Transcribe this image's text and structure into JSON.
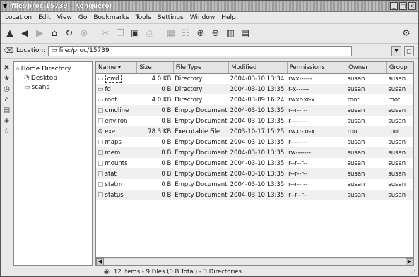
{
  "window": {
    "title": "file:/proc/15739 - Konqueror",
    "controls": [
      "_",
      "□",
      "×"
    ]
  },
  "menubar": [
    "Location",
    "Edit",
    "View",
    "Go",
    "Bookmarks",
    "Tools",
    "Settings",
    "Window",
    "Help"
  ],
  "toolbar": {
    "icons": [
      {
        "name": "up-arrow-icon",
        "glyph": "▲"
      },
      {
        "name": "back-arrow-icon",
        "glyph": "◀"
      },
      {
        "name": "forward-arrow-icon",
        "glyph": "▶"
      },
      {
        "name": "home-icon",
        "glyph": "⌂"
      },
      {
        "name": "reload-icon",
        "glyph": "↻"
      },
      {
        "name": "stop-icon",
        "glyph": "⊗"
      },
      {
        "name": "cut-icon",
        "glyph": "✂"
      },
      {
        "name": "copy-icon",
        "glyph": "❐"
      },
      {
        "name": "paste-icon",
        "glyph": "📋"
      },
      {
        "name": "print-icon",
        "glyph": "⎙"
      },
      {
        "name": "icon-view-icon",
        "glyph": "▦"
      },
      {
        "name": "list-view-icon",
        "glyph": "☷"
      },
      {
        "name": "zoom-in-icon",
        "glyph": "⊕"
      },
      {
        "name": "zoom-out-icon",
        "glyph": "⊖"
      },
      {
        "name": "multi-column-view-icon",
        "glyph": "▥"
      },
      {
        "name": "detailed-view-icon",
        "glyph": "▤"
      }
    ],
    "throbber_icon": "konqueror-logo-icon"
  },
  "location": {
    "label": "Location:",
    "value": "file:/proc/15739"
  },
  "tree": {
    "root": "Home Directory",
    "items": [
      "Desktop",
      "scans"
    ]
  },
  "table": {
    "columns": [
      "Name",
      "Size",
      "File Type",
      "Modified",
      "Permissions",
      "Owner",
      "Group"
    ],
    "sort_indicator": "▾",
    "rows": [
      {
        "name": "cwd",
        "icon": "folder-link-icon",
        "size": "4.0 KB",
        "type": "Directory",
        "modified": "2004-03-10 13:34",
        "perms": "rwx------",
        "owner": "susan",
        "group": "susan"
      },
      {
        "name": "fd",
        "icon": "folder-icon",
        "size": "0 B",
        "type": "Directory",
        "modified": "2004-03-10 13:35",
        "perms": "r-x------",
        "owner": "susan",
        "group": "susan"
      },
      {
        "name": "root",
        "icon": "folder-link-icon",
        "size": "4.0 KB",
        "type": "Directory",
        "modified": "2004-03-09 16:24",
        "perms": "rwxr-xr-x",
        "owner": "root",
        "group": "root"
      },
      {
        "name": "cmdline",
        "icon": "document-icon",
        "size": "0 B",
        "type": "Empty Document",
        "modified": "2004-03-10 13:35",
        "perms": "r--r--r--",
        "owner": "susan",
        "group": "susan"
      },
      {
        "name": "environ",
        "icon": "document-icon",
        "size": "0 B",
        "type": "Empty Document",
        "modified": "2004-03-10 13:35",
        "perms": "r--------",
        "owner": "susan",
        "group": "susan"
      },
      {
        "name": "exe",
        "icon": "executable-icon",
        "size": "78.3 KB",
        "type": "Executable File",
        "modified": "2003-10-17 15:25",
        "perms": "rwxr-xr-x",
        "owner": "root",
        "group": "root"
      },
      {
        "name": "maps",
        "icon": "document-icon",
        "size": "0 B",
        "type": "Empty Document",
        "modified": "2004-03-10 13:35",
        "perms": "r--------",
        "owner": "susan",
        "group": "susan"
      },
      {
        "name": "mem",
        "icon": "document-icon",
        "size": "0 B",
        "type": "Empty Document",
        "modified": "2004-03-10 13:35",
        "perms": "rw-------",
        "owner": "susan",
        "group": "susan"
      },
      {
        "name": "mounts",
        "icon": "document-icon",
        "size": "0 B",
        "type": "Empty Document",
        "modified": "2004-03-10 13:35",
        "perms": "r--r--r--",
        "owner": "susan",
        "group": "susan"
      },
      {
        "name": "stat",
        "icon": "document-icon",
        "size": "0 B",
        "type": "Empty Document",
        "modified": "2004-03-10 13:35",
        "perms": "r--r--r--",
        "owner": "susan",
        "group": "susan"
      },
      {
        "name": "statm",
        "icon": "document-icon",
        "size": "0 B",
        "type": "Empty Document",
        "modified": "2004-03-10 13:35",
        "perms": "r--r--r--",
        "owner": "susan",
        "group": "susan"
      },
      {
        "name": "status",
        "icon": "document-icon",
        "size": "0 B",
        "type": "Empty Document",
        "modified": "2004-03-10 13:35",
        "perms": "r--r--r--",
        "owner": "susan",
        "group": "susan"
      }
    ]
  },
  "status": {
    "text": "12 Items - 9 Files (0 B Total) - 3 Directories"
  }
}
